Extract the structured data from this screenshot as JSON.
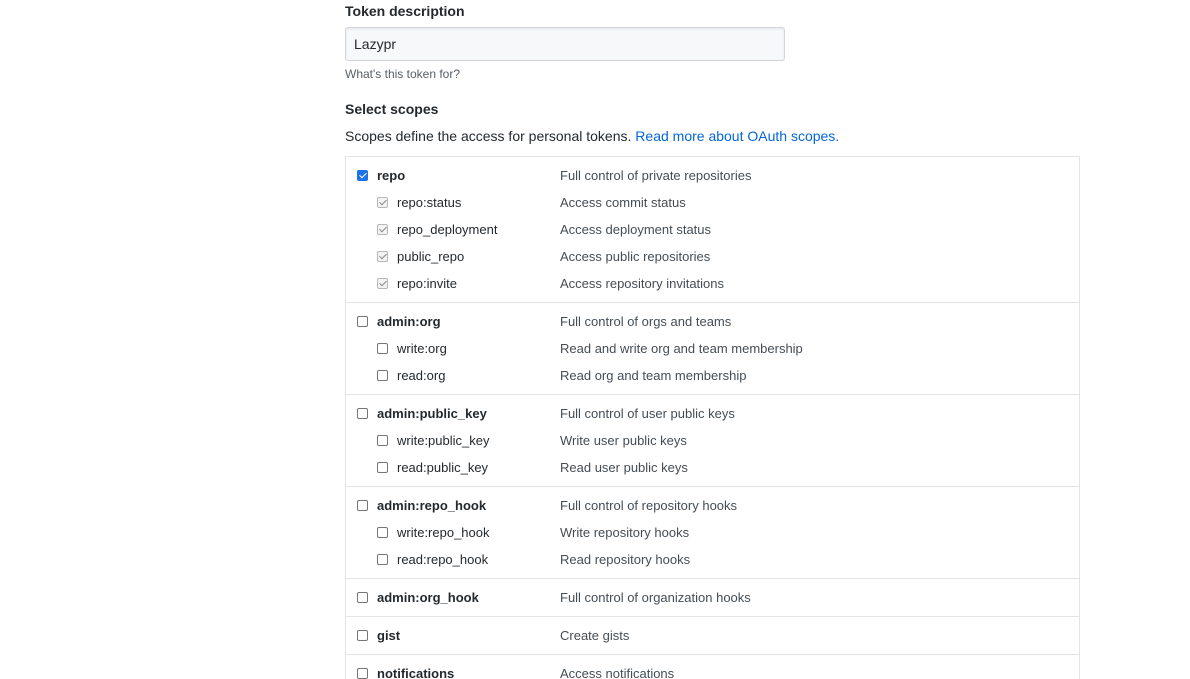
{
  "token": {
    "label": "Token description",
    "value": "Lazypr",
    "note": "What's this token for?"
  },
  "scopes": {
    "heading": "Select scopes",
    "description": "Scopes define the access for personal tokens.",
    "link_text": "Read more about OAuth scopes.",
    "groups": [
      {
        "name": "repo",
        "desc": "Full control of private repositories",
        "checked": true,
        "children": [
          {
            "name": "repo:status",
            "desc": "Access commit status",
            "checked": true
          },
          {
            "name": "repo_deployment",
            "desc": "Access deployment status",
            "checked": true
          },
          {
            "name": "public_repo",
            "desc": "Access public repositories",
            "checked": true
          },
          {
            "name": "repo:invite",
            "desc": "Access repository invitations",
            "checked": true
          }
        ]
      },
      {
        "name": "admin:org",
        "desc": "Full control of orgs and teams",
        "checked": false,
        "children": [
          {
            "name": "write:org",
            "desc": "Read and write org and team membership",
            "checked": false
          },
          {
            "name": "read:org",
            "desc": "Read org and team membership",
            "checked": false
          }
        ]
      },
      {
        "name": "admin:public_key",
        "desc": "Full control of user public keys",
        "checked": false,
        "children": [
          {
            "name": "write:public_key",
            "desc": "Write user public keys",
            "checked": false
          },
          {
            "name": "read:public_key",
            "desc": "Read user public keys",
            "checked": false
          }
        ]
      },
      {
        "name": "admin:repo_hook",
        "desc": "Full control of repository hooks",
        "checked": false,
        "children": [
          {
            "name": "write:repo_hook",
            "desc": "Write repository hooks",
            "checked": false
          },
          {
            "name": "read:repo_hook",
            "desc": "Read repository hooks",
            "checked": false
          }
        ]
      },
      {
        "name": "admin:org_hook",
        "desc": "Full control of organization hooks",
        "checked": false,
        "children": []
      },
      {
        "name": "gist",
        "desc": "Create gists",
        "checked": false,
        "children": []
      },
      {
        "name": "notifications",
        "desc": "Access notifications",
        "checked": false,
        "children": []
      }
    ]
  }
}
